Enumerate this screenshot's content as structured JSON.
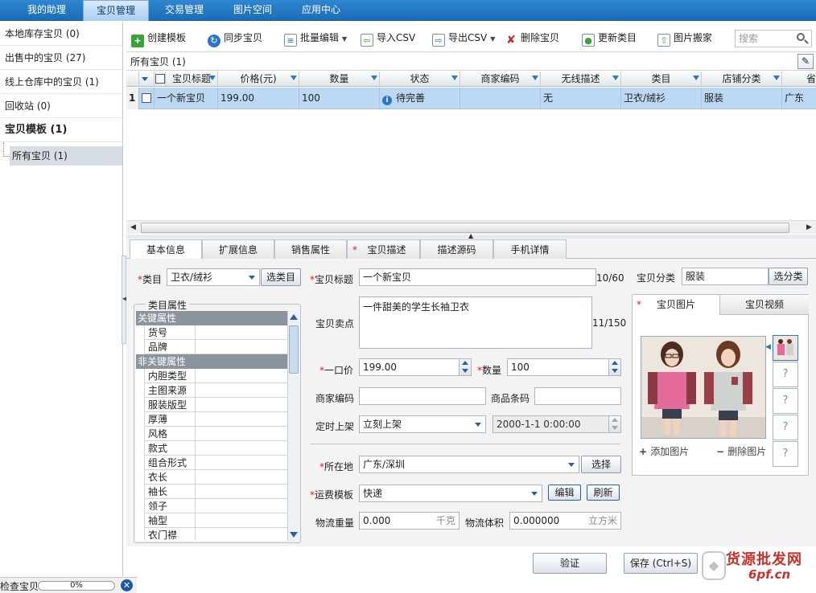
{
  "nav": {
    "tabs": [
      "我的助理",
      "宝贝管理",
      "交易管理",
      "图片空间",
      "应用中心"
    ],
    "active": "宝贝管理"
  },
  "sidebar": {
    "items": [
      {
        "label": "本地库存宝贝 (0)"
      },
      {
        "label": "出售中的宝贝 (27)"
      },
      {
        "label": "线上仓库中的宝贝 (1)"
      },
      {
        "label": "回收站 (0)"
      },
      {
        "label": "宝贝模板 (1)"
      }
    ],
    "sub_item": "所有宝贝 (1)"
  },
  "status": {
    "label": "检查宝贝",
    "progress_text": "0%",
    "progress": 0
  },
  "toolbar": {
    "create_template": "创建模板",
    "sync": "同步宝贝",
    "batch_edit": "批量编辑",
    "import_csv": "导入CSV",
    "export_csv": "导出CSV",
    "delete": "删除宝贝",
    "update_category": "更新类目",
    "image_move": "图片搬家",
    "search_placeholder": "搜索"
  },
  "grid": {
    "caption": "所有宝贝 (1)",
    "columns": [
      "宝贝标题",
      "价格(元)",
      "数量",
      "状态",
      "商家编码",
      "无线描述",
      "类目",
      "店铺分类",
      "省"
    ],
    "rows": [
      {
        "index": "1",
        "title": "一个新宝贝",
        "price": "199.00",
        "qty": "100",
        "status": "待完善",
        "code": "",
        "wireless": "无",
        "category": "卫衣/绒衫",
        "shop_cat": "服装",
        "province": "广东"
      }
    ]
  },
  "detail_tabs": [
    "基本信息",
    "扩展信息",
    "销售属性",
    "宝贝描述",
    "描述源码",
    "手机详情"
  ],
  "form": {
    "category_label": "类目",
    "category_value": "卫衣/绒衫",
    "select_category_btn": "选类目",
    "title_label": "宝贝标题",
    "title_value": "一个新宝贝",
    "title_counter": "10/60",
    "shop_category_label": "宝贝分类",
    "shop_category_value": "服装",
    "select_shop_category_btn": "选分类",
    "selling_point_label": "宝贝卖点",
    "selling_point_value": "一件甜美的学生长袖卫衣",
    "selling_point_counter": "11/150",
    "price_label": "一口价",
    "price_value": "199.00",
    "qty_label": "数量",
    "qty_value": "100",
    "merchant_code_label": "商家编码",
    "barcode_label": "商品条码",
    "schedule_label": "定时上架",
    "schedule_value": "立刻上架",
    "schedule_time": "2000-1-1 0:00:00",
    "location_label": "所在地",
    "location_value": "广东/深圳",
    "location_btn": "选择",
    "shipping_label": "运费模板",
    "shipping_value": "快递",
    "edit_btn": "编辑",
    "refresh_btn": "刷新",
    "weight_label": "物流重量",
    "weight_value": "0.000",
    "weight_unit": "千克",
    "volume_label": "物流体积",
    "volume_value": "0.000000",
    "volume_unit": "立方米"
  },
  "attributes": {
    "legend": "类目属性",
    "key_section": "关键属性",
    "key_items": [
      "货号",
      "品牌"
    ],
    "nonkey_section": "非关键属性",
    "nonkey_items": [
      "内胆类型",
      "主图来源",
      "服装版型",
      "厚薄",
      "风格",
      "款式",
      "组合形式",
      "衣长",
      "袖长",
      "领子",
      "袖型",
      "衣门襟"
    ]
  },
  "images": {
    "tab_images": "宝贝图片",
    "tab_video": "宝贝视频",
    "add_image": "添加图片",
    "delete_image": "删除图片"
  },
  "actions": {
    "validate": "验证",
    "save": "保存 (Ctrl+S)"
  },
  "watermark": {
    "line1": "货源批发网",
    "line2": "6pf.cn"
  }
}
